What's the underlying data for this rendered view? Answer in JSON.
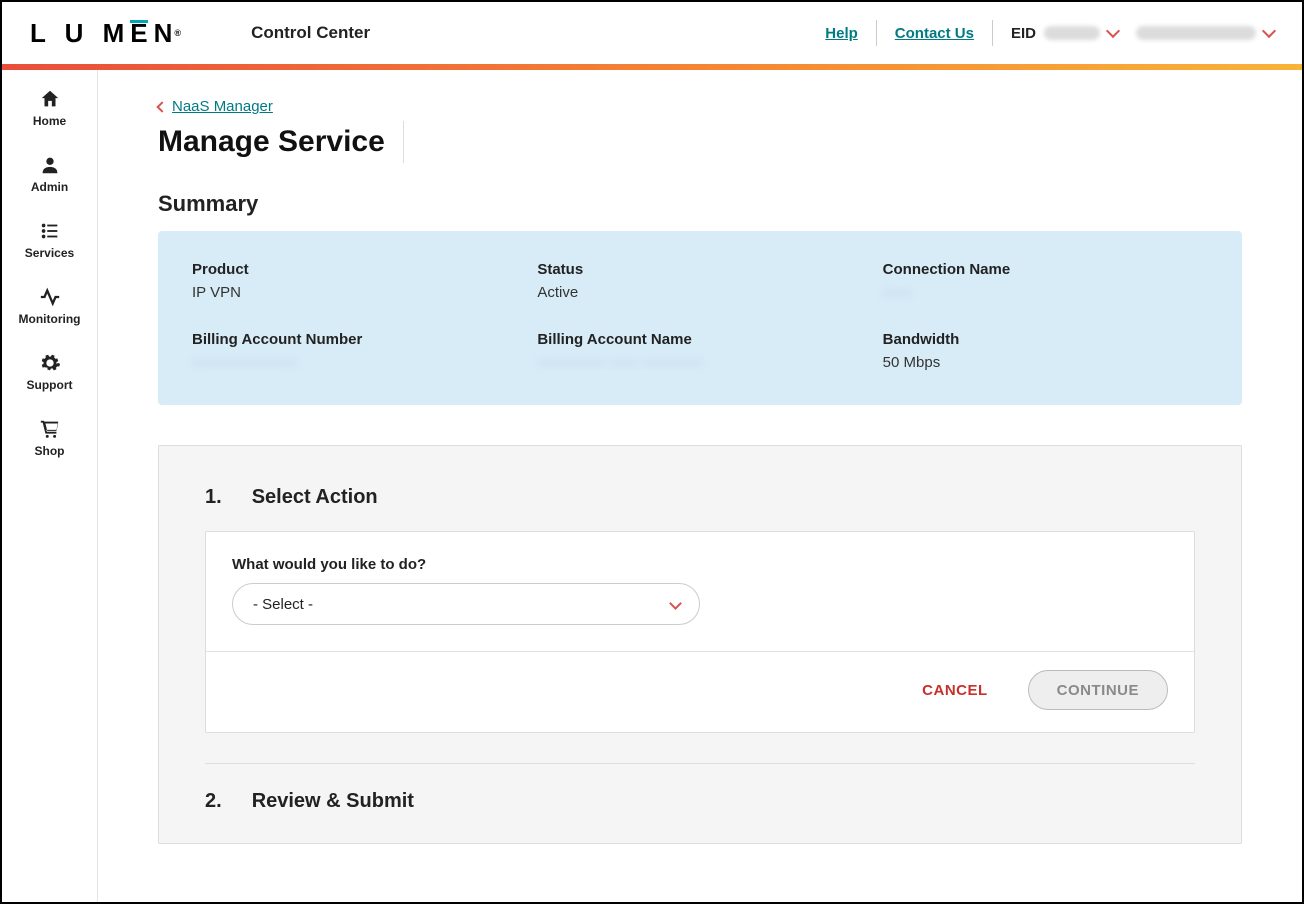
{
  "header": {
    "logo_text": "LUMEN",
    "logo_reg": "®",
    "app_name": "Control Center",
    "help": "Help",
    "contact": "Contact Us",
    "eid_label": "EID"
  },
  "sidebar": {
    "items": [
      {
        "label": "Home"
      },
      {
        "label": "Admin"
      },
      {
        "label": "Services"
      },
      {
        "label": "Monitoring"
      },
      {
        "label": "Support"
      },
      {
        "label": "Shop"
      }
    ]
  },
  "breadcrumb": {
    "back_label": "NaaS Manager"
  },
  "page": {
    "title": "Manage Service",
    "summary_title": "Summary"
  },
  "summary": {
    "product_label": "Product",
    "product_value": "IP VPN",
    "status_label": "Status",
    "status_value": "Active",
    "conn_label": "Connection Name",
    "ban_label": "Billing Account Number",
    "baname_label": "Billing Account Name",
    "bw_label": "Bandwidth",
    "bw_value": "50 Mbps"
  },
  "wizard": {
    "step1_num": "1.",
    "step1_title": "Select Action",
    "field_label": "What would you like to do?",
    "select_placeholder": "- Select -",
    "cancel": "CANCEL",
    "continue": "CONTINUE",
    "step2_num": "2.",
    "step2_title": "Review & Submit"
  }
}
